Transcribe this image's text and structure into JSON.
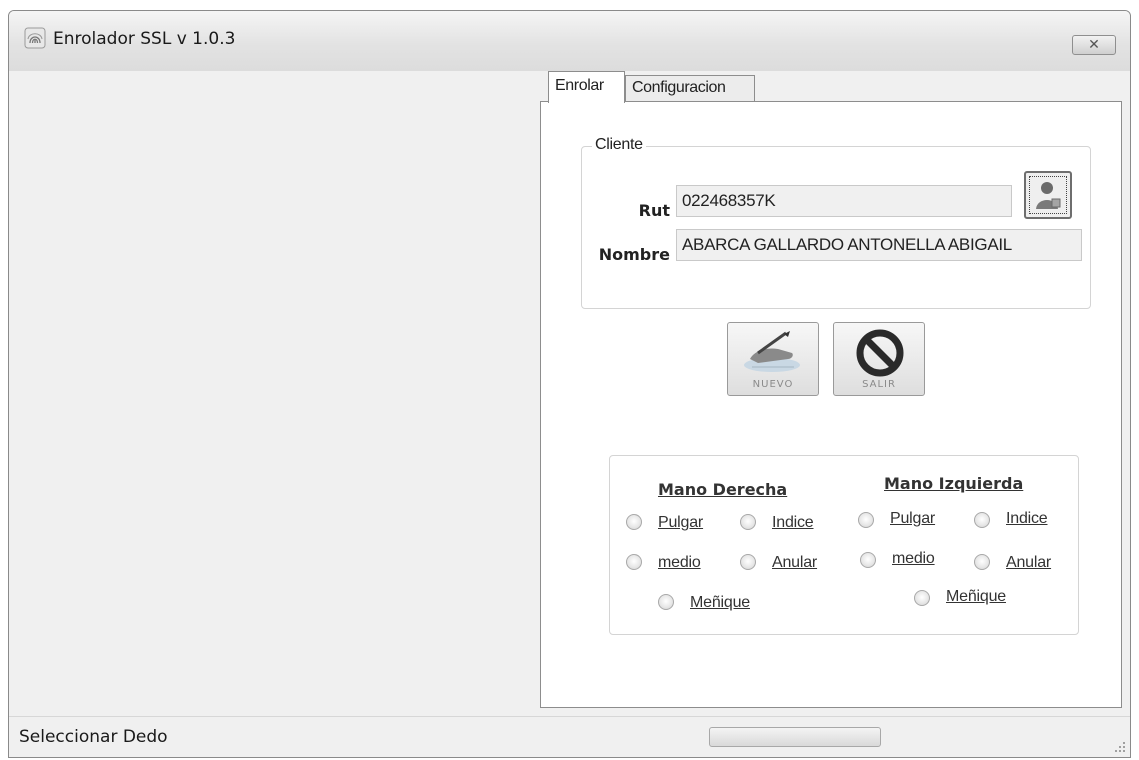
{
  "window": {
    "title": "Enrolador SSL v 1.0.3",
    "close_label": "✕"
  },
  "tabs": [
    {
      "label": "Enrolar"
    },
    {
      "label": "Configuracion"
    }
  ],
  "cliente": {
    "group_label": "Cliente",
    "rut_label": "Rut",
    "rut_value": "022468357K",
    "nombre_label": "Nombre",
    "nombre_value": "ABARCA GALLARDO ANTONELLA ABIGAIL",
    "lookup_icon": "user-search-icon"
  },
  "actions": {
    "nuevo_caption": "NUEVO",
    "salir_caption": "SALIR",
    "nuevo_icon": "hand-fingerprint-icon",
    "salir_icon": "no-entry-icon"
  },
  "dedos": {
    "right_title": "Mano Derecha",
    "left_title": "Mano Izquierda",
    "right": {
      "pulgar": "Pulgar",
      "indice": "Indice",
      "medio": "medio",
      "anular": "Anular",
      "menique": "Meñique"
    },
    "left": {
      "pulgar": "Pulgar",
      "indice": "Indice",
      "medio": "medio",
      "anular": "Anular",
      "menique": "Meñique"
    }
  },
  "status": {
    "text": "Seleccionar Dedo",
    "progress": 0
  },
  "colors": {
    "window_bg": "#f0f0f0",
    "panel_bg": "#ffffff",
    "progress_fill": "#3cb043"
  }
}
